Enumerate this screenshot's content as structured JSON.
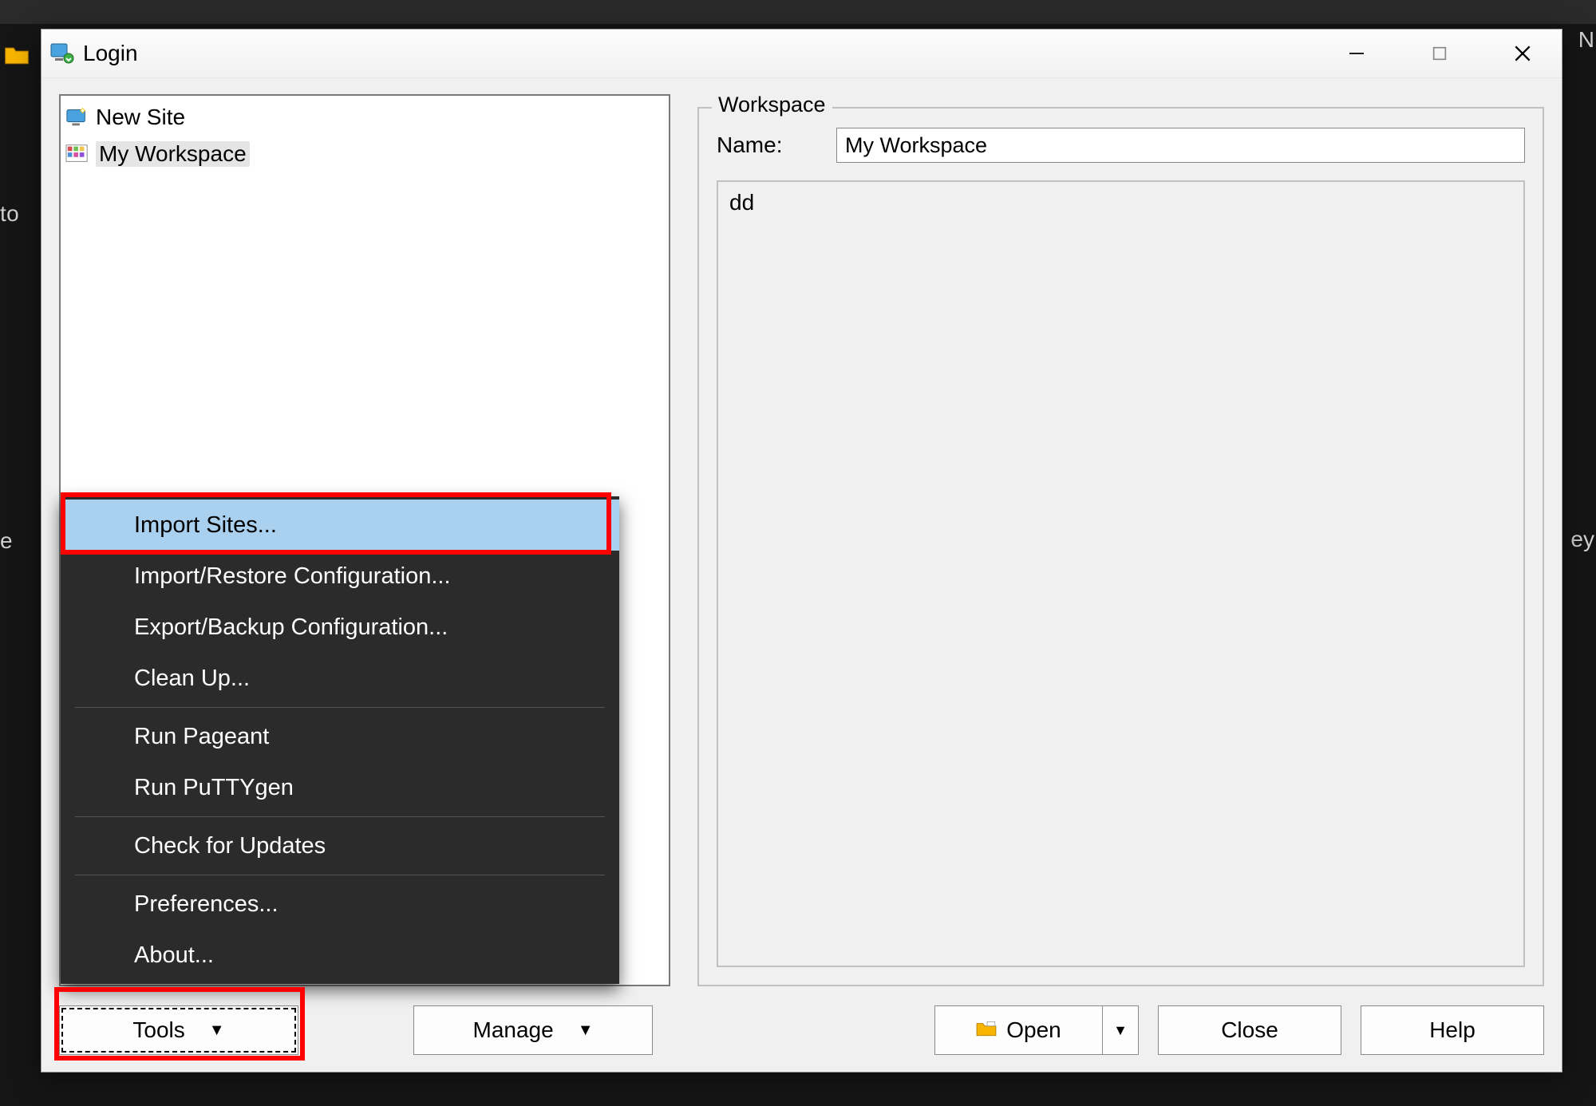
{
  "backdrop": {
    "left_text_1": "to",
    "left_text_2": "e",
    "right_text_1": "N",
    "right_text_2": "ey"
  },
  "dialog": {
    "title": "Login"
  },
  "sites": {
    "items": [
      {
        "label": "New Site"
      },
      {
        "label": "My Workspace"
      }
    ]
  },
  "left_buttons": {
    "tools_label": "Tools",
    "manage_label": "Manage"
  },
  "tools_menu": {
    "items": [
      {
        "label": "Import Sites..."
      },
      {
        "label": "Import/Restore Configuration..."
      },
      {
        "label": "Export/Backup Configuration..."
      },
      {
        "label": "Clean Up..."
      },
      {
        "label": "Run Pageant"
      },
      {
        "label": "Run PuTTYgen"
      },
      {
        "label": "Check for Updates"
      },
      {
        "label": "Preferences..."
      },
      {
        "label": "About..."
      }
    ]
  },
  "workspace_panel": {
    "legend": "Workspace",
    "name_label": "Name:",
    "name_value": "My Workspace",
    "description": "dd"
  },
  "right_buttons": {
    "open_label": "Open",
    "close_label": "Close",
    "help_label": "Help"
  }
}
